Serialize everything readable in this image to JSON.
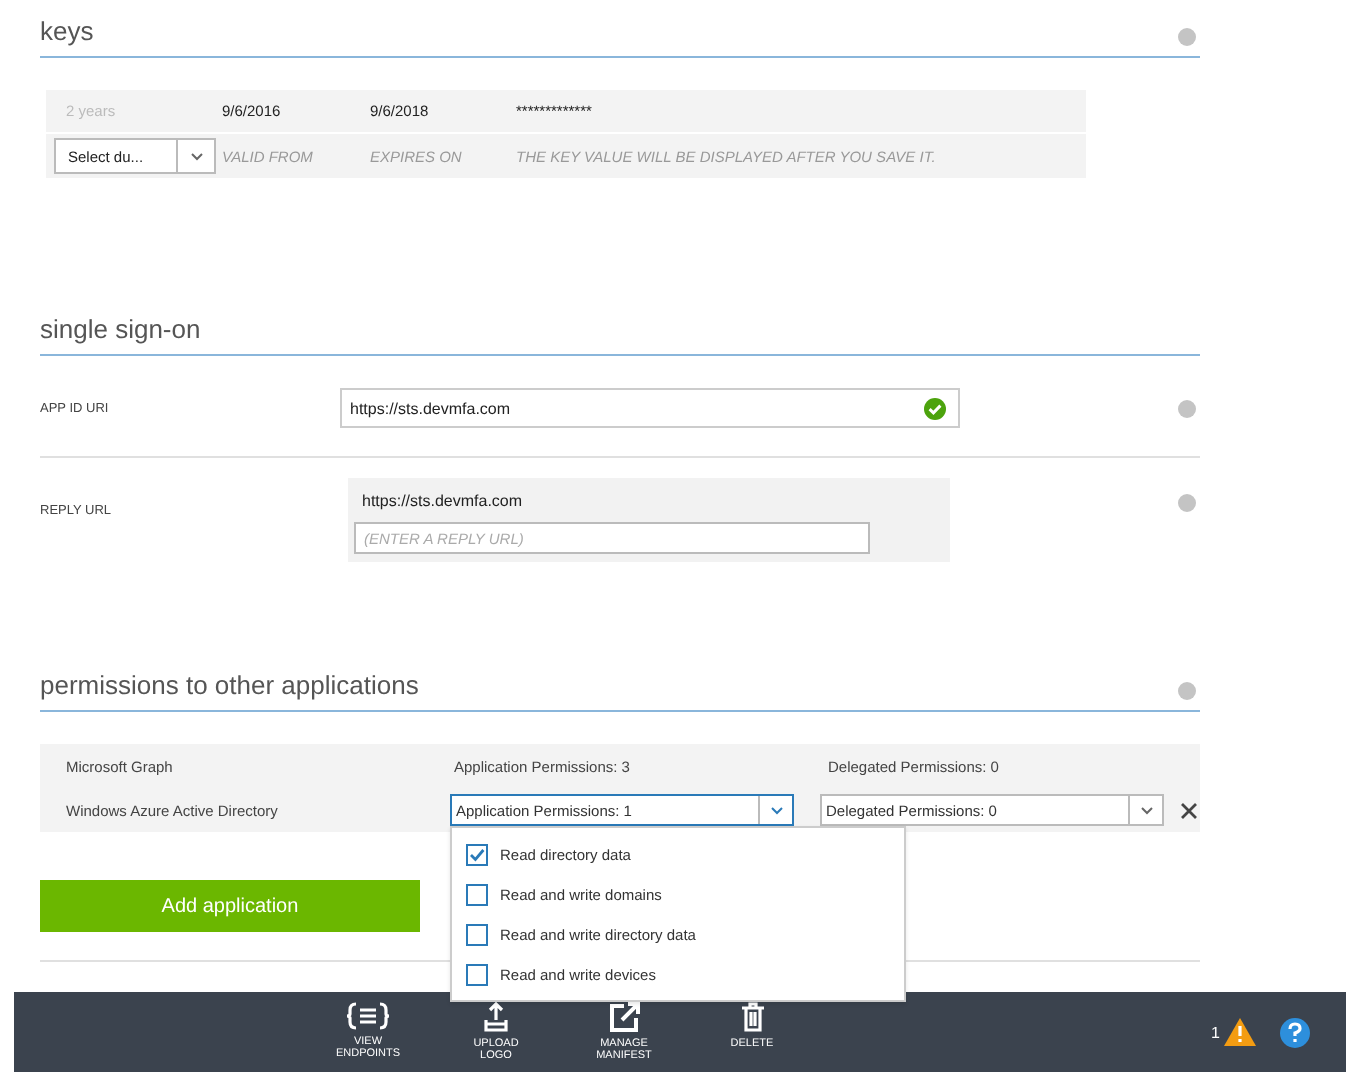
{
  "keys": {
    "title": "keys",
    "entries": [
      {
        "duration": "2 years",
        "valid_from": "9/6/2016",
        "expires_on": "9/6/2018",
        "value": "*************"
      }
    ],
    "new_entry": {
      "duration_select": "Select du...",
      "valid_from": "VALID FROM",
      "expires_on": "EXPIRES ON",
      "value_note": "THE KEY VALUE WILL BE DISPLAYED AFTER YOU SAVE IT."
    }
  },
  "single_sign_on": {
    "title": "single sign-on",
    "app_id_uri": {
      "label": "APP ID URI",
      "value": "https://sts.devmfa.com",
      "valid": true
    },
    "reply_url": {
      "label": "REPLY URL",
      "urls": [
        "https://sts.devmfa.com"
      ],
      "placeholder": "(ENTER A REPLY URL)"
    }
  },
  "permissions": {
    "title": "permissions to other applications",
    "applications": [
      {
        "name": "Microsoft Graph",
        "application_permissions": "Application Permissions: 3",
        "delegated_permissions": "Delegated Permissions: 0",
        "editing": false
      },
      {
        "name": "Windows Azure Active Directory",
        "application_permissions": "Application Permissions: 1",
        "delegated_permissions": "Delegated Permissions: 0",
        "editing": true
      }
    ],
    "open_dropdown": {
      "options": [
        {
          "label": "Read directory data",
          "checked": true
        },
        {
          "label": "Read and write domains",
          "checked": false
        },
        {
          "label": "Read and write directory data",
          "checked": false
        },
        {
          "label": "Read and write devices",
          "checked": false
        }
      ]
    },
    "add_button": "Add application"
  },
  "command_bar": {
    "commands": [
      {
        "kind": "endpoints",
        "label": "VIEW ENDPOINTS"
      },
      {
        "kind": "upload",
        "label": "UPLOAD LOGO"
      },
      {
        "kind": "manifest",
        "label": "MANAGE MANIFEST"
      },
      {
        "kind": "delete",
        "label": "DELETE"
      }
    ],
    "warning_count": "1"
  }
}
